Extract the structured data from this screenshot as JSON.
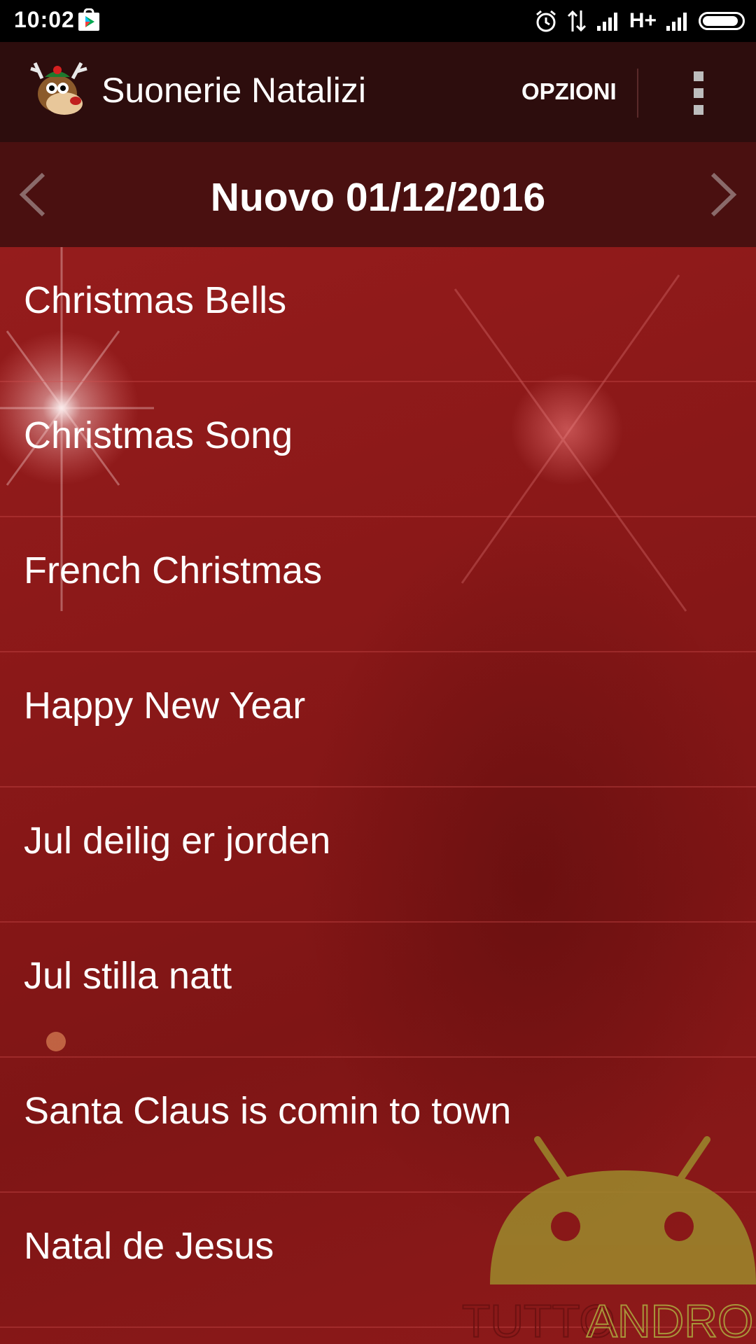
{
  "status_bar": {
    "time": "10:02",
    "network": "H+",
    "icons": [
      "play-store-icon",
      "alarm-icon",
      "data-transfer-icon",
      "signal-icon",
      "signal-icon",
      "battery-icon"
    ]
  },
  "app_bar": {
    "title": "Suonerie Natalizi",
    "options_label": "OPZIONI",
    "logo_icon": "reindeer-logo-icon",
    "menu_icon": "overflow-menu-icon"
  },
  "date_nav": {
    "title": "Nuovo 01/12/2016",
    "prev_icon": "chevron-left-icon",
    "next_icon": "chevron-right-icon"
  },
  "ringtones": [
    "Christmas Bells",
    "Christmas Song",
    "French Christmas",
    "Happy New Year",
    "Jul deilig er jorden",
    "Jul stilla natt",
    "Santa Claus is comin to town",
    "Natal de Jesus"
  ],
  "watermark": {
    "text_left": "TUTTO",
    "text_right": "ANDROID"
  },
  "colors": {
    "status_bar": "#000000",
    "app_bar": "#2d0d0d",
    "date_nav": "#4a1010",
    "list_bg": "#8a1818",
    "watermark": "#9c8a2c"
  }
}
